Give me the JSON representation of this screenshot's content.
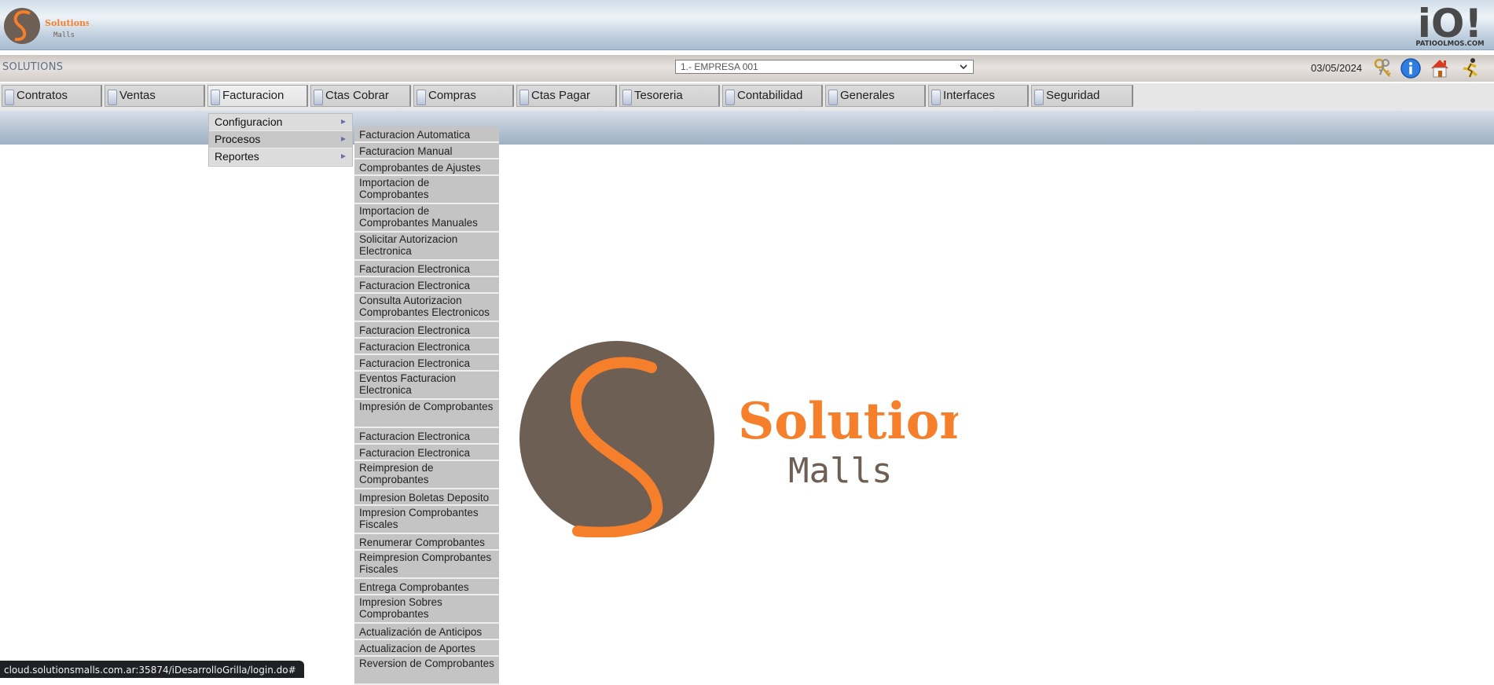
{
  "header": {
    "logo_small": {
      "brand": "Solutions",
      "sub": "Malls"
    },
    "right_logo": {
      "mark": "iO!",
      "caption": "PATIOOLMOS.COM"
    }
  },
  "infobar": {
    "app_title": "SOLUTIONS",
    "company_select": {
      "value": "1.- EMPRESA 001"
    },
    "date": "03/05/2024",
    "icons": [
      "keys-icon",
      "info-icon",
      "home-icon",
      "exit-runner-icon"
    ]
  },
  "menu": {
    "items": [
      "Contratos",
      "Ventas",
      "Facturacion",
      "Ctas Cobrar",
      "Compras",
      "Ctas Pagar",
      "Tesoreria",
      "Contabilidad",
      "Generales",
      "Interfaces",
      "Seguridad"
    ]
  },
  "dropdown_level1": {
    "items": [
      "Configuracion",
      "Procesos",
      "Reportes"
    ]
  },
  "dropdown_level2": {
    "items": [
      {
        "label": "Facturacion Automatica"
      },
      {
        "label": "Facturacion Manual"
      },
      {
        "label": "Comprobantes de Ajustes"
      },
      {
        "label": "Importacion de Comprobantes"
      },
      {
        "label": "Importacion de Comprobantes Manuales"
      },
      {
        "label": "Solicitar Autorizacion Electronica"
      },
      {
        "label": "Facturacion Electronica"
      },
      {
        "label": "Facturacion Electronica"
      },
      {
        "label": "Consulta Autorizacion Comprobantes Electronicos"
      },
      {
        "label": "Facturacion Electronica"
      },
      {
        "label": "Facturacion Electronica"
      },
      {
        "label": "Facturacion Electronica"
      },
      {
        "label": "Eventos Facturacion Electronica"
      },
      {
        "label": "Impresión de Comprobantes"
      },
      {
        "label": "Facturacion Electronica"
      },
      {
        "label": "Facturacion Electronica"
      },
      {
        "label": "Reimpresion de Comprobantes"
      },
      {
        "label": "Impresion Boletas Deposito"
      },
      {
        "label": "Impresion Comprobantes Fiscales"
      },
      {
        "label": "Renumerar Comprobantes"
      },
      {
        "label": "Reimpresion Comprobantes Fiscales"
      },
      {
        "label": "Entrega Comprobantes"
      },
      {
        "label": "Impresion Sobres Comprobantes"
      },
      {
        "label": "Actualización de Anticipos"
      },
      {
        "label": "Actualizacion de Aportes"
      },
      {
        "label": "Reversion de Comprobantes"
      }
    ]
  },
  "center_logo": {
    "brand": "Solutions",
    "sub": "Malls"
  },
  "status_bar": {
    "url": "cloud.solutionsmalls.com.ar:35874/iDesarrolloGrilla/login.do#"
  },
  "colors": {
    "brand_orange": "#f57f2a",
    "brand_brown": "#6e5f55"
  }
}
